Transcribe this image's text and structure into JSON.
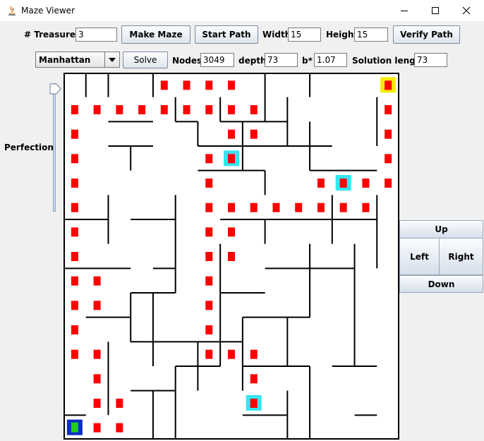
{
  "window": {
    "title": "Maze Viewer"
  },
  "toolbar": {
    "treasures_label": "# Treasures",
    "treasures_value": "3",
    "make_maze": "Make Maze",
    "start_path": "Start Path",
    "width_label": "Width",
    "width_value": "15",
    "height_label": "Height",
    "height_value": "15",
    "verify_path": "Verify Path"
  },
  "search": {
    "heuristic": "Manhattan",
    "solve": "Solve",
    "nodes_label": "Nodes",
    "nodes_value": "3049",
    "depth_label": "depth",
    "depth_value": "73",
    "bstar_label": "b*",
    "bstar_value": "1.07",
    "solution_label": "Solution length",
    "solution_value": "73"
  },
  "slider": {
    "label": "Perfection",
    "level": 0.0
  },
  "directions": {
    "up": "Up",
    "left": "Left",
    "right": "Right",
    "down": "Down"
  },
  "colors": {
    "path": "#ff0000",
    "treasure_border": "#33e6f0",
    "goal_border": "#f6ea00",
    "start_border": "#0a2dc8",
    "start_fill": "#22cc22",
    "wall": "#000000"
  },
  "maze": {
    "rows": 15,
    "cols": 15,
    "path": [
      [
        0,
        4
      ],
      [
        0,
        5
      ],
      [
        0,
        6
      ],
      [
        0,
        7
      ],
      [
        0,
        14
      ],
      [
        1,
        0
      ],
      [
        1,
        1
      ],
      [
        1,
        2
      ],
      [
        1,
        3
      ],
      [
        1,
        4
      ],
      [
        1,
        5
      ],
      [
        1,
        6
      ],
      [
        1,
        7
      ],
      [
        1,
        8
      ],
      [
        1,
        14
      ],
      [
        2,
        0
      ],
      [
        2,
        7
      ],
      [
        2,
        8
      ],
      [
        2,
        14
      ],
      [
        3,
        0
      ],
      [
        3,
        6
      ],
      [
        3,
        7
      ],
      [
        3,
        14
      ],
      [
        4,
        0
      ],
      [
        4,
        6
      ],
      [
        4,
        11
      ],
      [
        4,
        12
      ],
      [
        4,
        13
      ],
      [
        4,
        14
      ],
      [
        5,
        0
      ],
      [
        5,
        6
      ],
      [
        5,
        7
      ],
      [
        5,
        8
      ],
      [
        5,
        9
      ],
      [
        5,
        10
      ],
      [
        5,
        11
      ],
      [
        5,
        12
      ],
      [
        5,
        13
      ],
      [
        6,
        0
      ],
      [
        6,
        6
      ],
      [
        6,
        7
      ],
      [
        7,
        0
      ],
      [
        7,
        6
      ],
      [
        7,
        7
      ],
      [
        8,
        0
      ],
      [
        8,
        1
      ],
      [
        8,
        6
      ],
      [
        9,
        0
      ],
      [
        9,
        1
      ],
      [
        9,
        6
      ],
      [
        10,
        0
      ],
      [
        10,
        6
      ],
      [
        11,
        0
      ],
      [
        11,
        1
      ],
      [
        11,
        6
      ],
      [
        11,
        7
      ],
      [
        11,
        8
      ],
      [
        12,
        1
      ],
      [
        12,
        8
      ],
      [
        13,
        1
      ],
      [
        13,
        2
      ],
      [
        13,
        8
      ],
      [
        14,
        0
      ],
      [
        14,
        1
      ],
      [
        14,
        2
      ]
    ],
    "treasures": [
      [
        3,
        7
      ],
      [
        4,
        12
      ],
      [
        13,
        8
      ]
    ],
    "goal": [
      0,
      14
    ],
    "start": [
      14,
      0
    ],
    "h_walls": [
      [
        0,
        0,
        6
      ],
      [
        0,
        8,
        14
      ],
      [
        2,
        2,
        4
      ],
      [
        2,
        5,
        6
      ],
      [
        2,
        7,
        10
      ],
      [
        3,
        2,
        4
      ],
      [
        3,
        6,
        12
      ],
      [
        4,
        6,
        9
      ],
      [
        4,
        11,
        14
      ],
      [
        6,
        0,
        2
      ],
      [
        6,
        3,
        5
      ],
      [
        6,
        7,
        14
      ],
      [
        8,
        0,
        3
      ],
      [
        8,
        4,
        5
      ],
      [
        8,
        9,
        13
      ],
      [
        9,
        3,
        5
      ],
      [
        9,
        7,
        9
      ],
      [
        10,
        1,
        3
      ],
      [
        10,
        8,
        11
      ],
      [
        11,
        3,
        8
      ],
      [
        12,
        5,
        7
      ],
      [
        12,
        8,
        11
      ],
      [
        12,
        12,
        14
      ],
      [
        13,
        3,
        5
      ],
      [
        14,
        0,
        1
      ],
      [
        14,
        8,
        10
      ],
      [
        14,
        13,
        14
      ]
    ],
    "v_walls": [
      [
        1,
        0,
        1
      ],
      [
        2,
        0,
        1
      ],
      [
        3,
        3,
        4
      ],
      [
        4,
        0,
        1
      ],
      [
        4,
        9,
        10
      ],
      [
        5,
        1,
        2
      ],
      [
        6,
        2,
        3
      ],
      [
        7,
        1,
        2
      ],
      [
        8,
        2,
        4
      ],
      [
        8,
        10,
        13
      ],
      [
        9,
        0,
        2
      ],
      [
        9,
        4,
        5
      ],
      [
        9,
        6,
        7
      ],
      [
        10,
        1,
        3
      ],
      [
        10,
        10,
        12
      ],
      [
        11,
        2,
        4
      ],
      [
        11,
        7,
        10
      ],
      [
        11,
        12,
        15
      ],
      [
        12,
        5,
        7
      ],
      [
        13,
        7,
        12
      ],
      [
        14,
        1,
        3
      ],
      [
        14,
        5,
        8
      ],
      [
        2,
        5,
        7
      ],
      [
        3,
        9,
        11
      ],
      [
        5,
        5,
        9
      ],
      [
        5,
        12,
        15
      ],
      [
        6,
        11,
        13
      ],
      [
        7,
        7,
        12
      ],
      [
        4,
        10,
        12
      ],
      [
        4,
        13,
        15
      ],
      [
        2,
        11,
        14
      ],
      [
        10,
        13,
        15
      ],
      [
        11,
        0,
        1
      ]
    ]
  }
}
